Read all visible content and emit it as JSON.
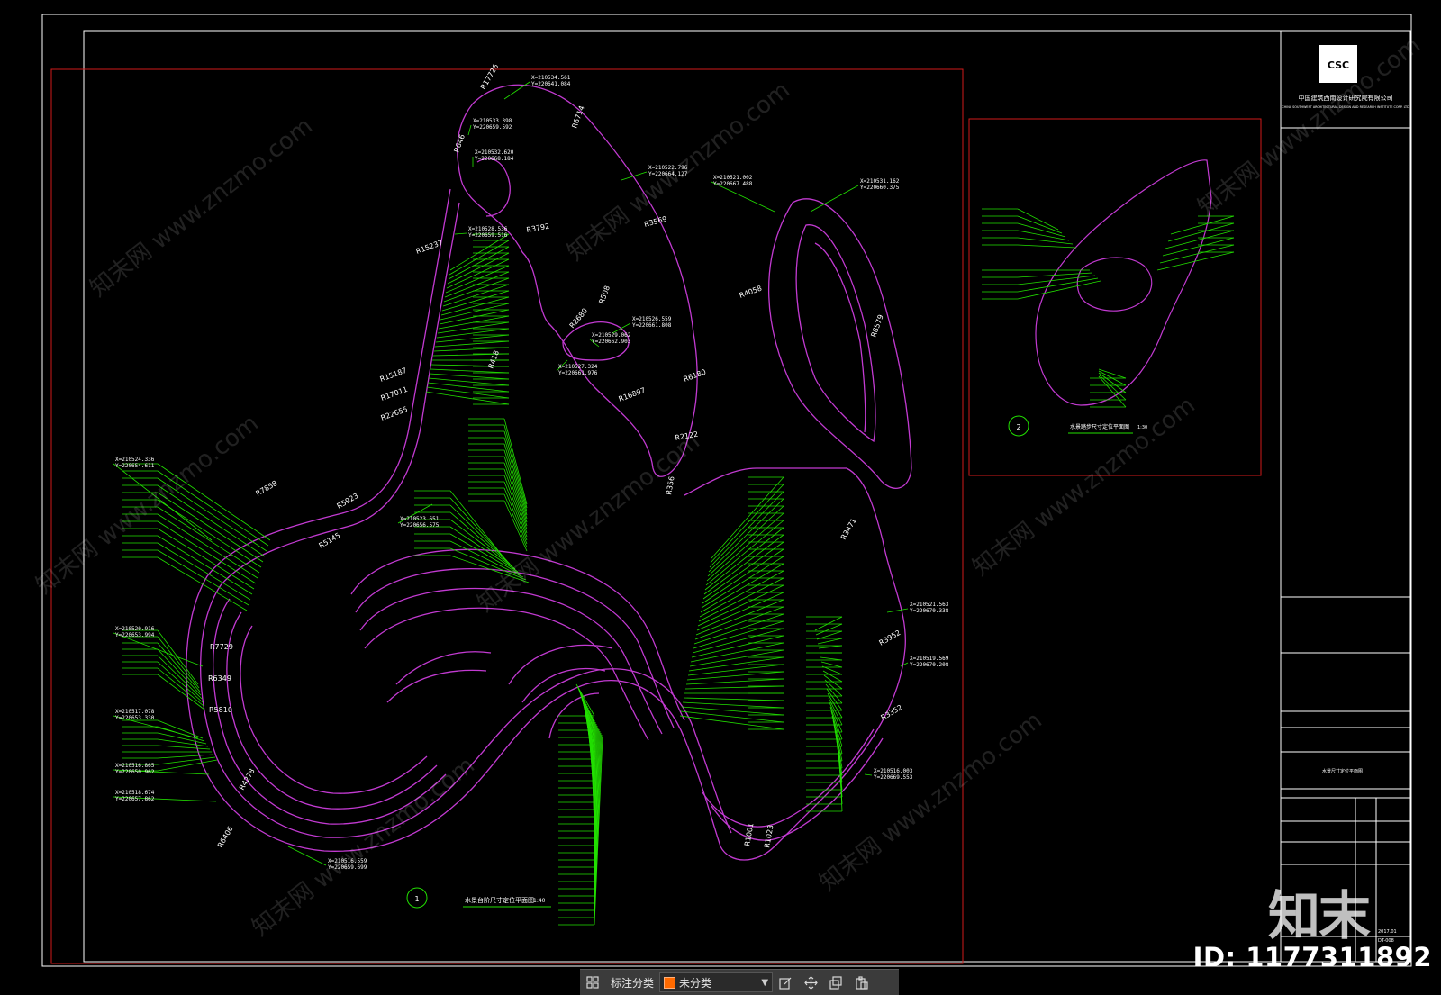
{
  "drawing": {
    "detail1_tag": "1",
    "detail1_title": "水景台阶尺寸定位平面图",
    "detail1_scale": "1:40",
    "detail2_tag": "2",
    "detail2_title": "水景踏步尺寸定位平面图",
    "detail2_scale": "1:30",
    "radius_labels": [
      "R15237",
      "R3792",
      "R3569",
      "R6714",
      "R17726",
      "R646",
      "R508",
      "R2680",
      "R418",
      "R6180",
      "R16897",
      "R2122",
      "R356",
      "R4058",
      "R8579",
      "R3471",
      "R15187",
      "R17011",
      "R22655",
      "R3952",
      "R3352",
      "R7858",
      "R5923",
      "R5145",
      "R7729",
      "R6349",
      "R5810",
      "R4278",
      "R6406",
      "R1001",
      "R1023"
    ],
    "coord_labels": [
      "X=210534.561",
      "Y=220641.084",
      "X=210533.398",
      "Y=220659.592",
      "X=210532.620",
      "Y=220668.184",
      "X=210522.796",
      "Y=220664.127",
      "X=210528.536",
      "Y=220659.516",
      "X=210521.002",
      "Y=220667.488",
      "X=210531.162",
      "Y=220660.375",
      "X=210526.559",
      "Y=220661.808",
      "X=210529.062",
      "Y=220662.903",
      "X=210527.324",
      "Y=220661.976",
      "X=210524.336",
      "Y=220654.611",
      "X=210520.916",
      "Y=220653.994",
      "X=210517.078",
      "Y=220653.330",
      "X=210516.865",
      "Y=220650.962",
      "X=210518.674",
      "Y=220657.862",
      "X=210516.559",
      "Y=220659.699",
      "X=210523.651",
      "Y=220656.575",
      "X=210521.563",
      "Y=220670.338",
      "X=210519.569",
      "Y=220670.208",
      "X=210516.003",
      "Y=220669.553"
    ],
    "titleblock": {
      "company_cn": "中国建筑西南设计研究院有限公司",
      "company_en": "CHINA SOUTHWEST ARCHITECTURAL DESIGN AND RESEARCH INSTITUTE CORP. LTD",
      "logo_text": "CSC",
      "sheet_title": "水景尺寸定位平面图",
      "sheet_no": "DT-008",
      "date": "2017.01"
    }
  },
  "toolbar": {
    "grid_icon": "grid-icon",
    "label": "标注分类",
    "select_value": "未分类",
    "select_color": "#ff6a00",
    "tools": [
      "edit-icon",
      "move-icon",
      "copy-icon",
      "paste-icon"
    ]
  },
  "overlay": {
    "id_text": "ID: 1177311892",
    "brand_text": "知末",
    "watermark": "知末网 www.znzmo.com"
  },
  "colors": {
    "outline": "#c23ad1",
    "leader": "#22e000",
    "frame_red": "#d11a1a",
    "frame_white": "#ffffff"
  }
}
